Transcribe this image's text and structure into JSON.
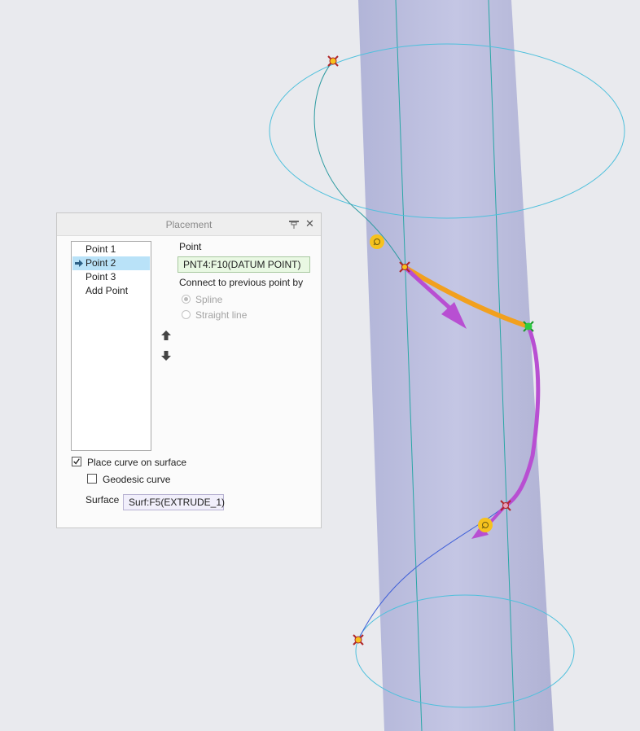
{
  "viewport": {
    "geometry": "cylinder-surface-with-curve"
  },
  "panel": {
    "title": "Placement",
    "points": [
      {
        "label": "Point 1",
        "selected": false
      },
      {
        "label": "Point 2",
        "selected": true
      },
      {
        "label": "Point 3",
        "selected": false
      },
      {
        "label": "Add Point",
        "selected": false
      }
    ],
    "point_label": "Point",
    "point_value": "PNT4:F10(DATUM POINT)",
    "connect_label": "Connect to previous point by",
    "spline_label": "Spline",
    "straight_label": "Straight line",
    "connect_selected": "Spline",
    "place_on_surface_label": "Place curve on surface",
    "place_on_surface_checked": true,
    "geodesic_label": "Geodesic curve",
    "geodesic_checked": false,
    "surface_label": "Surface",
    "surface_value": "Surf:F5(EXTRUDE_1)"
  },
  "colors": {
    "background": "#e9eaee",
    "cylinder": "#bcbedf",
    "edge": "#2aa6a6",
    "circle": "#4fc0dc",
    "handle": "#b84fd2",
    "segment": "#f2a01e",
    "point": "#f6c21d",
    "active_point": "#2ecc40",
    "datum_marker": "#b0272a"
  }
}
